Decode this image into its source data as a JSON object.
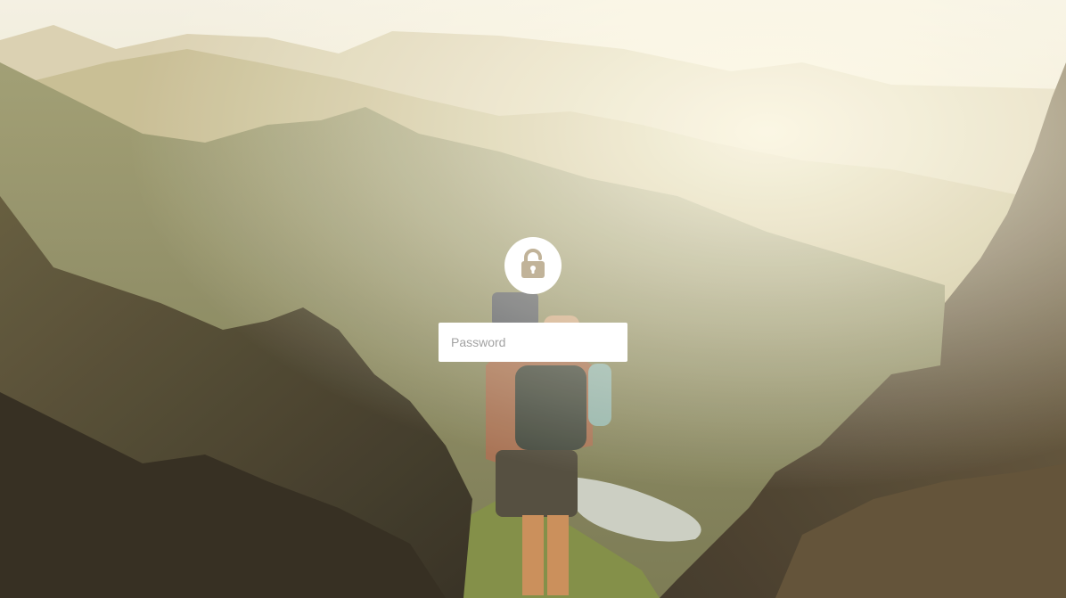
{
  "login": {
    "password_placeholder": "Password",
    "password_value": "",
    "lock_icon": "padlock-icon"
  },
  "colors": {
    "sky": "#f3efdf",
    "haze": "#ddd3ad",
    "mountain_far": "#b8ad86",
    "mountain_mid": "#8b8a5c",
    "cliff_dark": "#3c3322",
    "lock_icon": "#c1b399",
    "panel": "#ffffff"
  }
}
